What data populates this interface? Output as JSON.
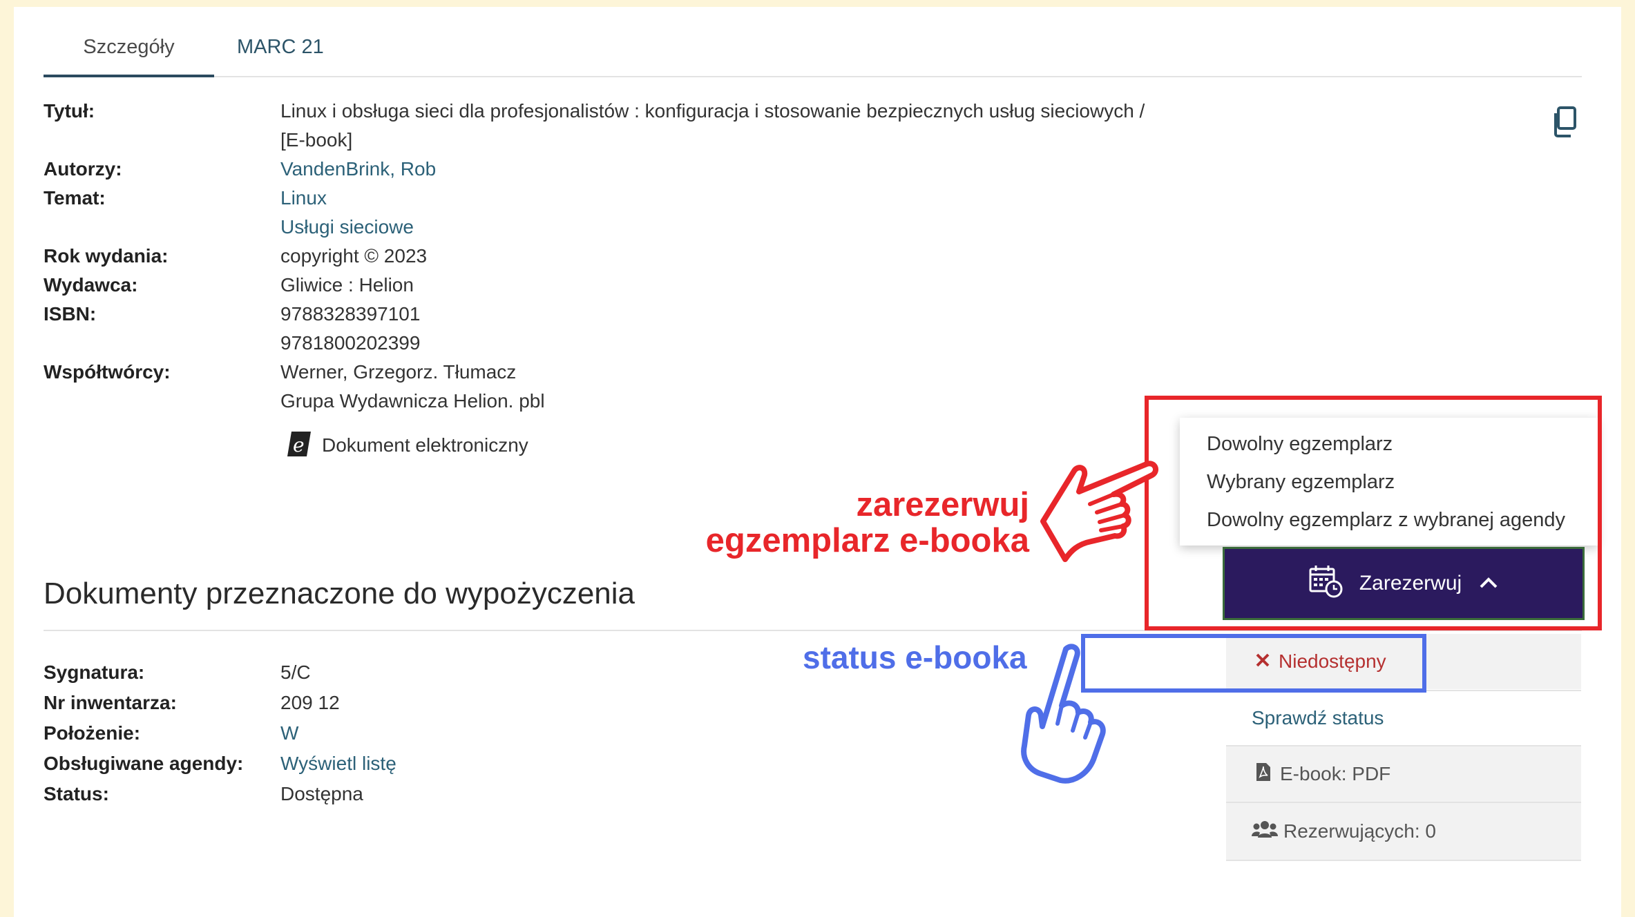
{
  "tabs": {
    "details": "Szczegóły",
    "marc": "MARC 21"
  },
  "record": {
    "title_label": "Tytuł:",
    "title_line1": "Linux i obsługa sieci dla profesjonalistów : konfiguracja i stosowanie bezpiecznych usług sieciowych /",
    "title_line2": "[E-book]",
    "authors_label": "Autorzy:",
    "author": "VandenBrink, Rob",
    "subject_label": "Temat:",
    "subject1": "Linux",
    "subject2": "Usługi sieciowe",
    "year_label": "Rok wydania:",
    "year": "copyright © 2023",
    "publisher_label": "Wydawca:",
    "publisher": "Gliwice : Helion",
    "isbn_label": "ISBN:",
    "isbn1": "9788328397101",
    "isbn2": "9781800202399",
    "contributors_label": "Współtwórcy:",
    "contributor1": "Werner, Grzegorz. Tłumacz",
    "contributor2": "Grupa Wydawnicza Helion. pbl",
    "doc_type": "Dokument elektroniczny"
  },
  "loan_section": {
    "title": "Dokumenty przeznaczone do wypożyczenia",
    "signature_label": "Sygnatura:",
    "signature": "5/C",
    "inventory_label": "Nr inwentarza:",
    "inventory": "209 12",
    "location_label": "Położenie:",
    "location": "W",
    "agencies_label": "Obsługiwane agendy:",
    "agencies_link": "Wyświetl listę",
    "status_label": "Status:",
    "status": "Dostępna"
  },
  "actions": {
    "reserve_label": "Zarezerwuj",
    "dropdown": [
      "Dowolny egzemplarz",
      "Wybrany egzemplarz",
      "Dowolny egzemplarz z wybranej agendy"
    ],
    "unavailable": "Niedostępny",
    "check_status": "Sprawdź status",
    "ebook_format": "E-book: PDF",
    "reserving_count": "Rezerwujących: 0"
  },
  "annotations": {
    "red_line1": "zarezerwuj",
    "red_line2": "egzemplarz e-booka",
    "blue": "status e-booka"
  },
  "colors": {
    "brand_purple": "#2b1a5e",
    "annotation_red": "#e8262a",
    "annotation_blue": "#4f6ee8",
    "link": "#2c6178"
  }
}
